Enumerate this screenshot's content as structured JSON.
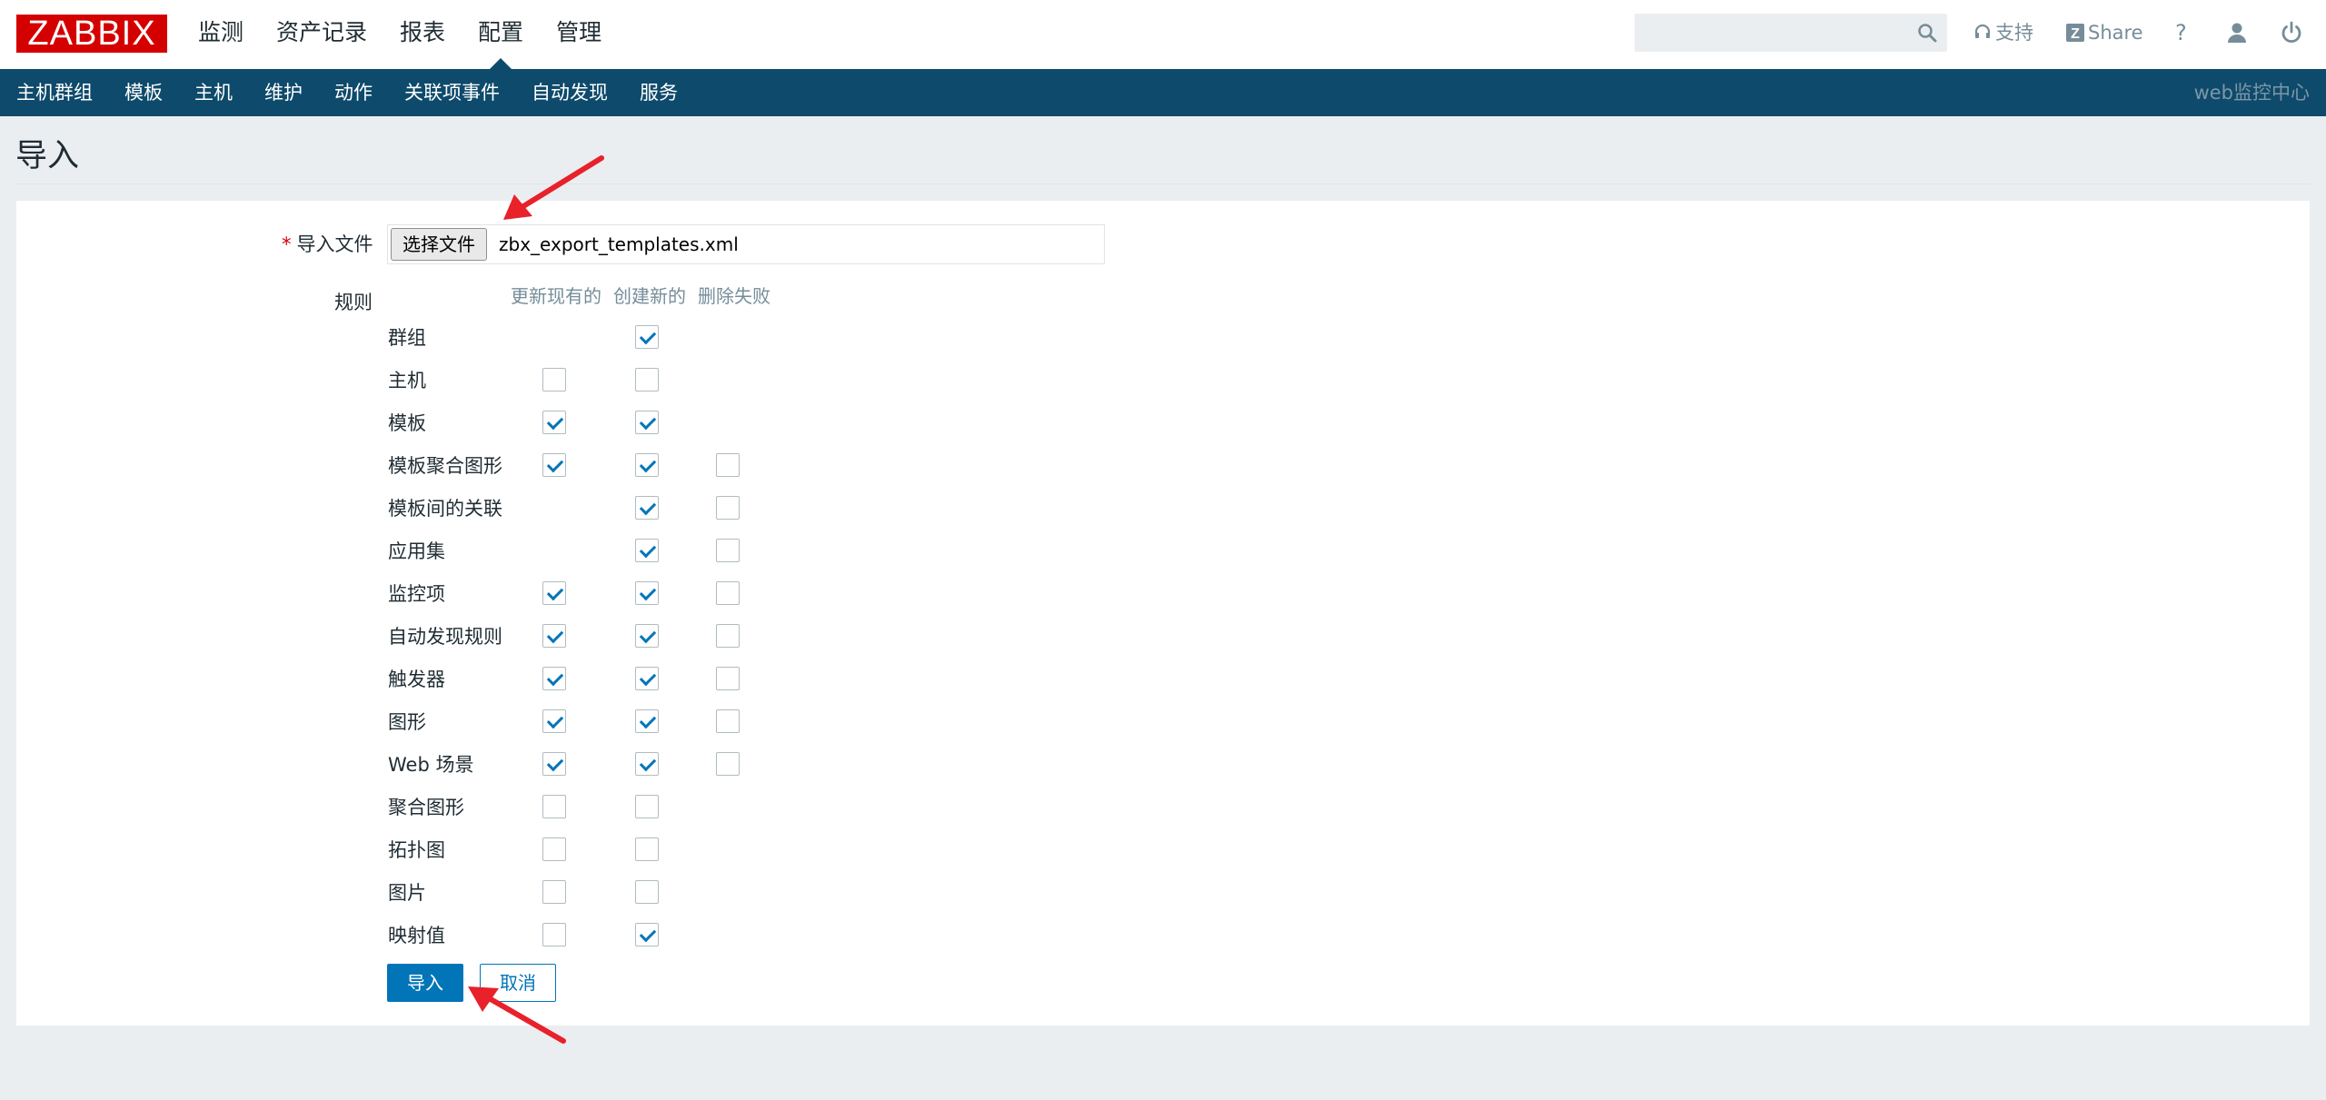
{
  "header": {
    "logo": "ZABBIX",
    "nav": [
      "监测",
      "资产记录",
      "报表",
      "配置",
      "管理"
    ],
    "active_nav": "配置",
    "search_placeholder": "",
    "support_label": "支持",
    "share_label": "Share",
    "help_label": "?"
  },
  "subnav": {
    "items": [
      "主机群组",
      "模板",
      "主机",
      "维护",
      "动作",
      "关联项事件",
      "自动发现",
      "服务"
    ],
    "server_name": "web监控中心"
  },
  "page": {
    "title": "导入"
  },
  "form": {
    "file_label": "导入文件",
    "required_mark": "*",
    "choose_file_label": "选择文件",
    "file_name": "zbx_export_templates.xml",
    "rules_label": "规则",
    "columns": [
      "更新现有的",
      "创建新的",
      "删除失败"
    ],
    "rules": [
      {
        "name": "群组",
        "update": null,
        "create": true,
        "delete": null
      },
      {
        "name": "主机",
        "update": false,
        "create": false,
        "delete": null
      },
      {
        "name": "模板",
        "update": true,
        "create": true,
        "delete": null
      },
      {
        "name": "模板聚合图形",
        "update": true,
        "create": true,
        "delete": false
      },
      {
        "name": "模板间的关联",
        "update": null,
        "create": true,
        "delete": false
      },
      {
        "name": "应用集",
        "update": null,
        "create": true,
        "delete": false
      },
      {
        "name": "监控项",
        "update": true,
        "create": true,
        "delete": false
      },
      {
        "name": "自动发现规则",
        "update": true,
        "create": true,
        "delete": false
      },
      {
        "name": "触发器",
        "update": true,
        "create": true,
        "delete": false
      },
      {
        "name": "图形",
        "update": true,
        "create": true,
        "delete": false
      },
      {
        "name": "Web 场景",
        "update": true,
        "create": true,
        "delete": false
      },
      {
        "name": "聚合图形",
        "update": false,
        "create": false,
        "delete": null
      },
      {
        "name": "拓扑图",
        "update": false,
        "create": false,
        "delete": null
      },
      {
        "name": "图片",
        "update": false,
        "create": false,
        "delete": null
      },
      {
        "name": "映射值",
        "update": false,
        "create": true,
        "delete": null
      }
    ],
    "import_button": "导入",
    "cancel_button": "取消"
  },
  "colors": {
    "brand_red": "#d40000",
    "nav_dark": "#0e4a6b",
    "accent_blue": "#0275b8",
    "annotation_arrow": "#e8212b"
  }
}
